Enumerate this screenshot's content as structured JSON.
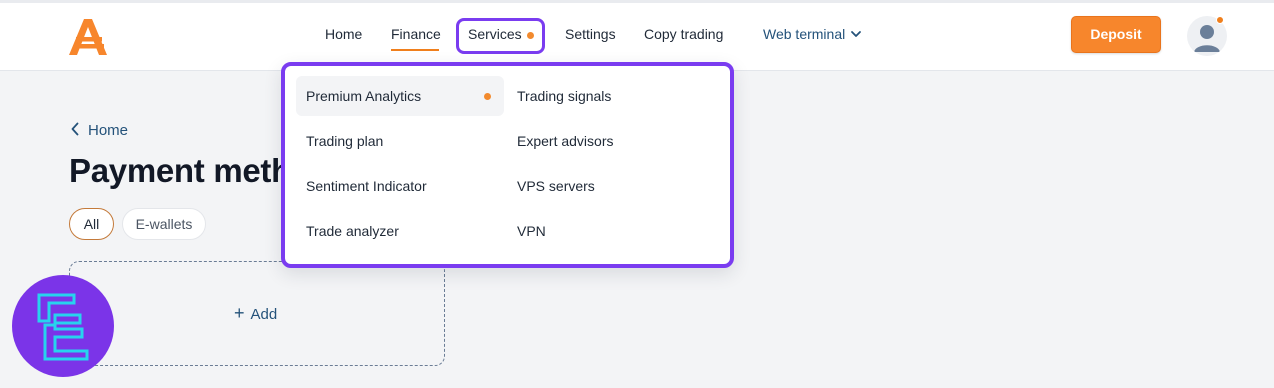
{
  "header": {
    "nav": {
      "home": "Home",
      "finance": "Finance",
      "services": "Services",
      "settings": "Settings",
      "copy_trading": "Copy trading",
      "web_terminal": "Web terminal"
    },
    "deposit_label": "Deposit"
  },
  "services_menu": {
    "left": [
      "Premium Analytics",
      "Trading plan",
      "Sentiment Indicator",
      "Trade analyzer"
    ],
    "right": [
      "Trading signals",
      "Expert advisors",
      "VPS servers",
      "VPN"
    ]
  },
  "page": {
    "back_label": "Home",
    "title": "Payment meth",
    "filters": {
      "all": "All",
      "ewallets": "E-wallets"
    },
    "add_label": "Add"
  },
  "colors": {
    "accent_orange": "#f7862c",
    "highlight_purple": "#7a3cf0",
    "link_blue": "#24527a"
  }
}
